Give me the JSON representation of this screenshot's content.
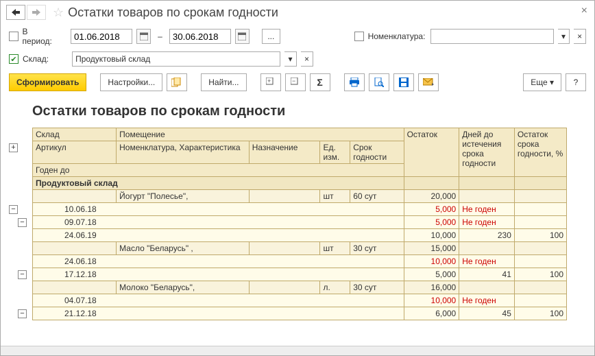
{
  "window": {
    "title": "Остатки товаров по срокам годности"
  },
  "filters": {
    "periodLabel": "В период:",
    "dateFrom": "01.06.2018",
    "dateSep": "–",
    "dateTo": "30.06.2018",
    "nomenclatureLabel": "Номенклатура:",
    "nomenclatureValue": "",
    "warehouseLabel": "Склад:",
    "warehouseValue": "Продуктовый склад"
  },
  "toolbar": {
    "run": "Сформировать",
    "settings": "Настройки...",
    "find": "Найти...",
    "more": "Еще",
    "help": "?"
  },
  "report": {
    "title": "Остатки товаров по срокам годности",
    "headers": {
      "r1c1": "Склад",
      "r1c2": "Помещение",
      "r1c3": "Остаток",
      "r1c4": "Дней до истечения срока годности",
      "r1c5": "Остаток срока годности, %",
      "r2c1": "Артикул",
      "r2c2": "Номенклатура, Характеристика",
      "r2c3": "Назначение",
      "r2c4": "Ед. изм.",
      "r2c5": "Срок годности",
      "r3c1": "Годен до"
    },
    "rows": [
      {
        "type": "lvl0",
        "c1": "Продуктовый склад"
      },
      {
        "type": "lvl1",
        "c2": "Йогурт \"Полесье\",",
        "c4": "шт",
        "c5": "60 сут",
        "ost": "20,000"
      },
      {
        "type": "lvl2",
        "c1": "10.06.18",
        "ost": "5,000",
        "days": "Не годен",
        "red": true
      },
      {
        "type": "lvl2",
        "c1": "09.07.18",
        "ost": "5,000",
        "days": "Не годен",
        "red": true
      },
      {
        "type": "lvl2",
        "c1": "24.06.19",
        "ost": "10,000",
        "days": "230",
        "pct": "100"
      },
      {
        "type": "lvl1",
        "c2": "Масло \"Беларусь\" ,",
        "c4": "шт",
        "c5": "30 сут",
        "ost": "15,000"
      },
      {
        "type": "lvl2",
        "c1": "24.06.18",
        "ost": "10,000",
        "days": "Не годен",
        "red": true
      },
      {
        "type": "lvl2",
        "c1": "17.12.18",
        "ost": "5,000",
        "days": "41",
        "pct": "100"
      },
      {
        "type": "lvl1",
        "c2": "Молоко \"Беларусь\",",
        "c4": "л.",
        "c5": "30 сут",
        "ost": "16,000"
      },
      {
        "type": "lvl2",
        "c1": "04.07.18",
        "ost": "10,000",
        "days": "Не годен",
        "red": true
      },
      {
        "type": "lvl2",
        "c1": "21.12.18",
        "ost": "6,000",
        "days": "45",
        "pct": "100"
      }
    ]
  }
}
